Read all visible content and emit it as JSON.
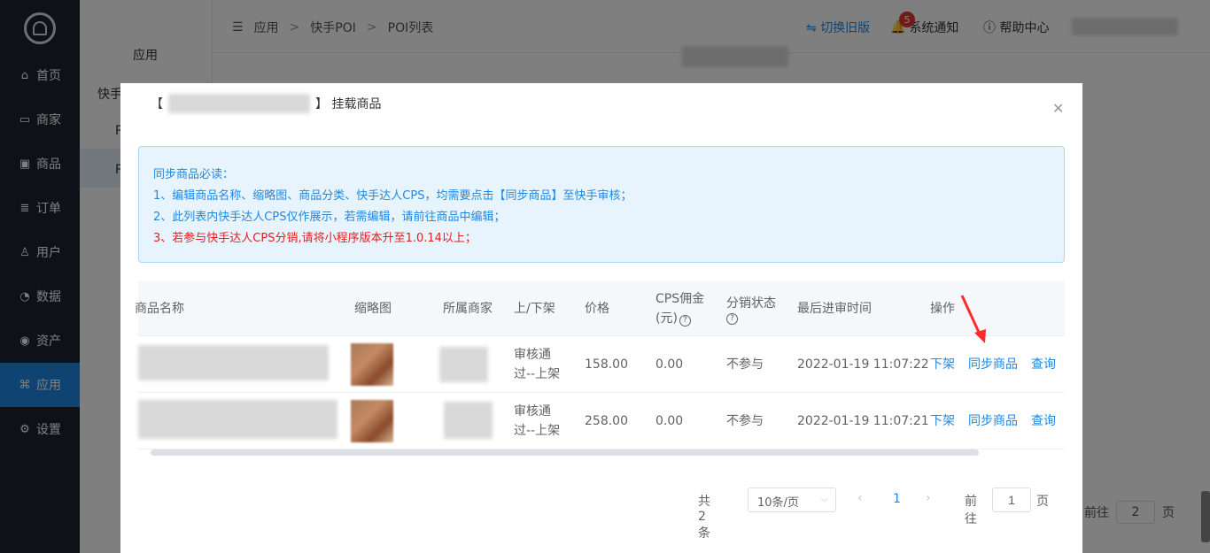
{
  "sidebar": {
    "items": [
      {
        "label": "首页",
        "icon": "home-icon"
      },
      {
        "label": "商家",
        "icon": "store-icon"
      },
      {
        "label": "商品",
        "icon": "box-icon"
      },
      {
        "label": "订单",
        "icon": "order-icon"
      },
      {
        "label": "用户",
        "icon": "user-icon"
      },
      {
        "label": "数据",
        "icon": "pie-chart-icon"
      },
      {
        "label": "资产",
        "icon": "coin-icon"
      },
      {
        "label": "应用",
        "icon": "apps-icon"
      },
      {
        "label": "设置",
        "icon": "gear-icon"
      }
    ],
    "active_index": 7
  },
  "sub_sidebar": {
    "title": "应用",
    "item1": "快手",
    "item2": "P",
    "item3": "P"
  },
  "header": {
    "breadcrumb": [
      "应用",
      "快手POI",
      "POI列表"
    ],
    "switch_label": "切换旧版",
    "notice_count": "5",
    "notice_label": "系统通知",
    "help_label": "帮助中心"
  },
  "background_pager": {
    "goto_label": "前往",
    "page_value": "2",
    "page_suffix": "页"
  },
  "dialog": {
    "title_prefix": "【",
    "title_suffix": "】 挂载商品",
    "alert": {
      "heading": "同步商品必读：",
      "line1": "1、编辑商品名称、缩略图、商品分类、快手达人CPS，均需要点击【同步商品】至快手审核；",
      "line2": "2、此列表内快手达人CPS仅作展示，若需编辑，请前往商品中编辑；",
      "line3": "3、若参与快手达人CPS分销,请将小程序版本升至1.0.14以上；"
    },
    "table": {
      "headers": {
        "name": "商品名称",
        "thumb": "缩略图",
        "merchant": "所属商家",
        "status": "上/下架",
        "price": "价格",
        "cps": "CPS佣金",
        "cps_unit": "(元)",
        "dist": "分销状态",
        "audit_time": "最后进审时间",
        "ops": "操作"
      },
      "rows": [
        {
          "status_line1": "审核通",
          "status_line2": "过--上架",
          "price": "158.00",
          "cps": "0.00",
          "dist": "不参与",
          "audit_time": "2022-01-19 11:07:22",
          "op_down": "下架",
          "op_sync": "同步商品",
          "op_query": "查询"
        },
        {
          "status_line1": "审核通",
          "status_line2": "过--上架",
          "price": "258.00",
          "cps": "0.00",
          "dist": "不参与",
          "audit_time": "2022-01-19 11:07:21",
          "op_down": "下架",
          "op_sync": "同步商品",
          "op_query": "查询"
        }
      ]
    },
    "pager": {
      "total": "共 2 条",
      "size": "10条/页",
      "current": "1",
      "goto": "前往",
      "goto_value": "1",
      "page_suffix": "页"
    }
  },
  "colors": {
    "accent": "#1e88e5",
    "sidebar_bg": "#1d2430",
    "warning_red": "#e02020",
    "arrow_red": "#ff2a2a"
  }
}
